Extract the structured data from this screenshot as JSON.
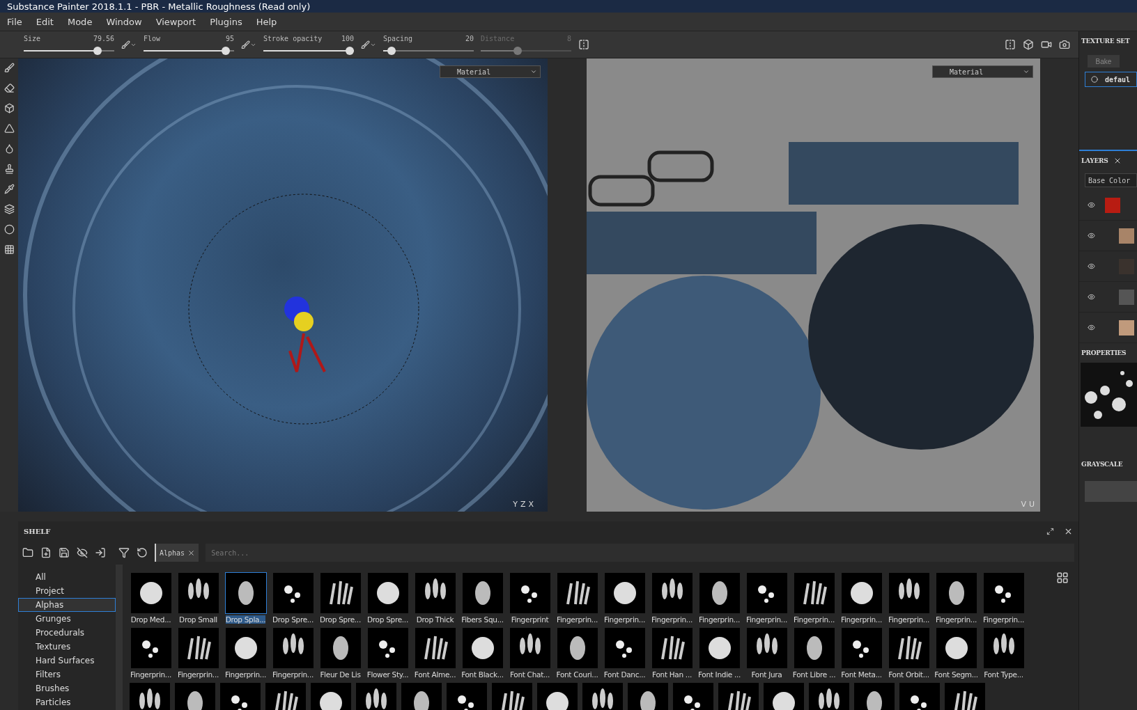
{
  "window": {
    "title": "Substance Painter 2018.1.1 - PBR - Metallic Roughness (Read only)"
  },
  "menu": [
    "File",
    "Edit",
    "Mode",
    "Window",
    "Viewport",
    "Plugins",
    "Help"
  ],
  "tool_options": [
    {
      "label": "Size",
      "value": "79.56",
      "level": 0.85,
      "disabled": false
    },
    {
      "label": "Flow",
      "value": "95",
      "level": 0.95,
      "disabled": false
    },
    {
      "label": "Stroke opacity",
      "value": "100",
      "level": 1.0,
      "disabled": false
    },
    {
      "label": "Spacing",
      "value": "20",
      "level": 0.05,
      "disabled": false
    },
    {
      "label": "Distance",
      "value": "8",
      "level": 0.4,
      "disabled": true
    }
  ],
  "viewport_3d": {
    "channel": "Material",
    "axes": [
      "Y",
      "Z",
      "X"
    ]
  },
  "viewport_2d": {
    "channel": "Material",
    "axes": [
      "V",
      "U"
    ]
  },
  "shelf": {
    "title": "SHELF",
    "filter_chip": "Alphas",
    "search": {
      "placeholder": "Search..."
    },
    "categories": [
      {
        "label": "All",
        "selected": false
      },
      {
        "label": "Project",
        "selected": false
      },
      {
        "label": "Alphas",
        "selected": true
      },
      {
        "label": "Grunges",
        "selected": false
      },
      {
        "label": "Procedurals",
        "selected": false
      },
      {
        "label": "Textures",
        "selected": false
      },
      {
        "label": "Hard Surfaces",
        "selected": false
      },
      {
        "label": "Filters",
        "selected": false
      },
      {
        "label": "Brushes",
        "selected": false
      },
      {
        "label": "Particles",
        "selected": false
      }
    ],
    "rows": [
      [
        {
          "label": "Drop Med...",
          "selected": false
        },
        {
          "label": "Drop Small",
          "selected": false
        },
        {
          "label": "Drop Spla...",
          "selected": true
        },
        {
          "label": "Drop Spre...",
          "selected": false
        },
        {
          "label": "Drop Spre...",
          "selected": false
        },
        {
          "label": "Drop Spre...",
          "selected": false
        },
        {
          "label": "Drop Thick",
          "selected": false
        },
        {
          "label": "Fibers Squ...",
          "selected": false
        },
        {
          "label": "Fingerprint",
          "selected": false
        },
        {
          "label": "Fingerprin...",
          "selected": false
        },
        {
          "label": "Fingerprin...",
          "selected": false
        },
        {
          "label": "Fingerprin...",
          "selected": false
        },
        {
          "label": "Fingerprin...",
          "selected": false
        },
        {
          "label": "Fingerprin...",
          "selected": false
        },
        {
          "label": "Fingerprin...",
          "selected": false
        },
        {
          "label": "Fingerprin...",
          "selected": false
        },
        {
          "label": "Fingerprin...",
          "selected": false
        },
        {
          "label": "Fingerprin...",
          "selected": false
        },
        {
          "label": "Fingerprin...",
          "selected": false
        }
      ],
      [
        {
          "label": "Fingerprin...",
          "selected": false
        },
        {
          "label": "Fingerprin...",
          "selected": false
        },
        {
          "label": "Fingerprin...",
          "selected": false
        },
        {
          "label": "Fingerprin...",
          "selected": false
        },
        {
          "label": "Fleur De Lis",
          "selected": false
        },
        {
          "label": "Flower Sty...",
          "selected": false
        },
        {
          "label": "Font Alme...",
          "selected": false
        },
        {
          "label": "Font Black...",
          "selected": false
        },
        {
          "label": "Font Chat...",
          "selected": false
        },
        {
          "label": "Font Couri...",
          "selected": false
        },
        {
          "label": "Font Danc...",
          "selected": false
        },
        {
          "label": "Font Han ...",
          "selected": false
        },
        {
          "label": "Font Indie ...",
          "selected": false
        },
        {
          "label": "Font Jura",
          "selected": false
        },
        {
          "label": "Font Libre ...",
          "selected": false
        },
        {
          "label": "Font Meta...",
          "selected": false
        },
        {
          "label": "Font Orbit...",
          "selected": false
        },
        {
          "label": "Font Segm...",
          "selected": false
        },
        {
          "label": "Font Type...",
          "selected": false
        }
      ]
    ]
  },
  "texture_set": {
    "title": "TEXTURE SET",
    "button": {
      "label": "Bake",
      "disabled": true
    },
    "item": "defaul"
  },
  "layers": {
    "title": "LAYERS",
    "channel": "Base Color",
    "items": [
      {
        "color": "#b81c12"
      },
      {
        "color": "#a88468"
      },
      {
        "color": "#3a322d"
      },
      {
        "color": "#555555"
      },
      {
        "color": "#c09a7c"
      }
    ]
  },
  "properties": {
    "title": "PROPERTIES"
  },
  "grayscale": {
    "title": "GRAYSCALE"
  }
}
